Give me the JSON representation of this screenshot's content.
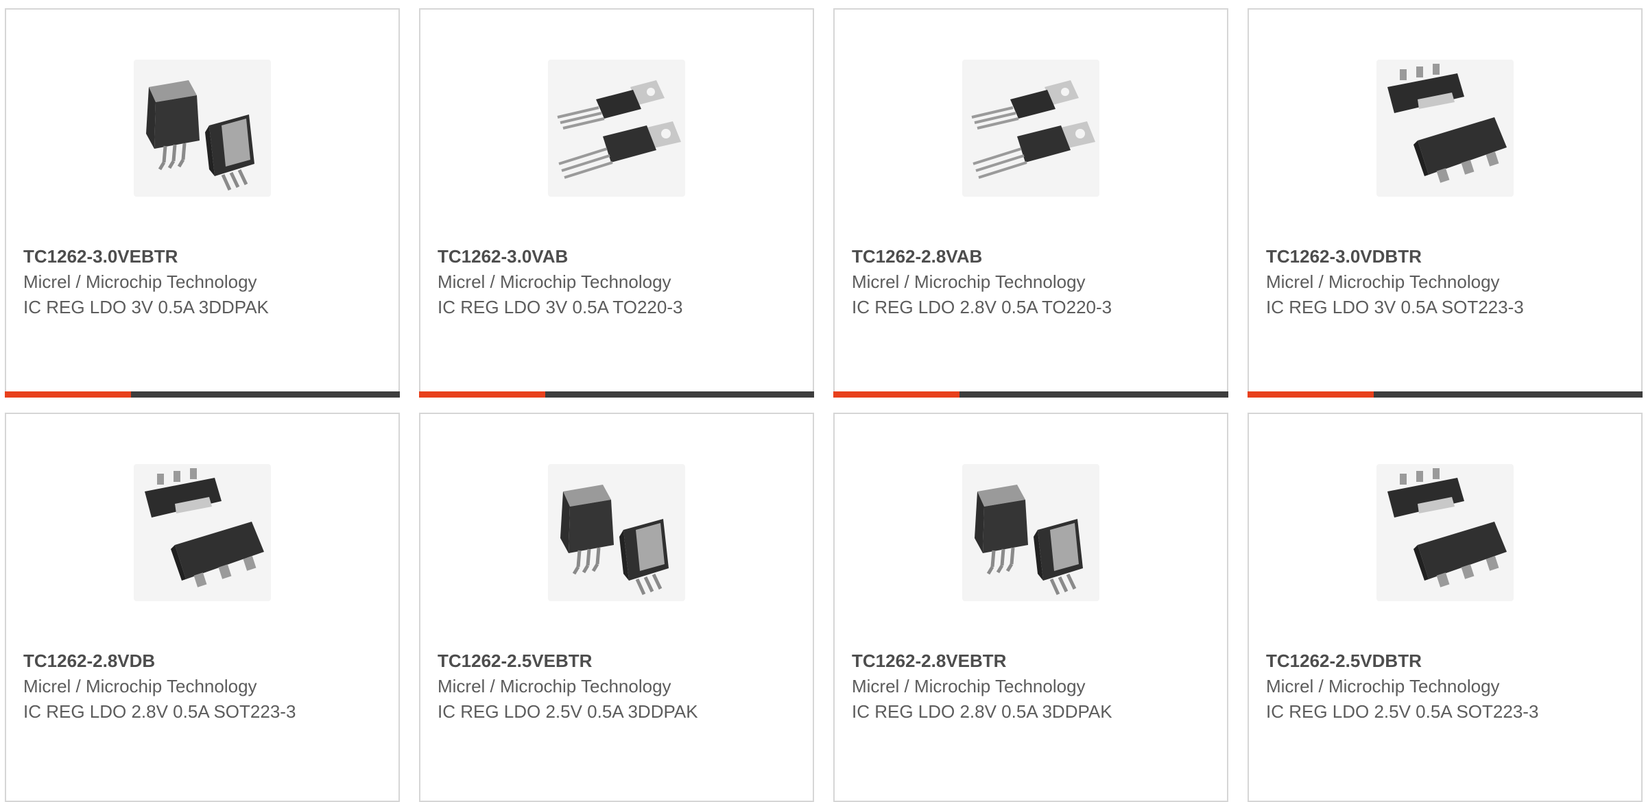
{
  "colors": {
    "accent": "#e8401c",
    "bar": "#3d3d3d",
    "border": "#d6d6d6",
    "text": "#5c5c5c"
  },
  "products": [
    {
      "part_number": "TC1262-3.0VEBTR",
      "manufacturer": "Micrel / Microchip Technology",
      "description": "IC REG LDO 3V 0.5A 3DDPAK",
      "package_icon": "ddpak-package-icon"
    },
    {
      "part_number": "TC1262-3.0VAB",
      "manufacturer": "Micrel / Microchip Technology",
      "description": "IC REG LDO 3V 0.5A TO220-3",
      "package_icon": "to220-package-icon"
    },
    {
      "part_number": "TC1262-2.8VAB",
      "manufacturer": "Micrel / Microchip Technology",
      "description": "IC REG LDO 2.8V 0.5A TO220-3",
      "package_icon": "to220-package-icon"
    },
    {
      "part_number": "TC1262-3.0VDBTR",
      "manufacturer": "Micrel / Microchip Technology",
      "description": "IC REG LDO 3V 0.5A SOT223-3",
      "package_icon": "sot223-package-icon"
    },
    {
      "part_number": "TC1262-2.8VDB",
      "manufacturer": "Micrel / Microchip Technology",
      "description": "IC REG LDO 2.8V 0.5A SOT223-3",
      "package_icon": "sot223-package-icon"
    },
    {
      "part_number": "TC1262-2.5VEBTR",
      "manufacturer": "Micrel / Microchip Technology",
      "description": "IC REG LDO 2.5V 0.5A 3DDPAK",
      "package_icon": "ddpak-package-icon"
    },
    {
      "part_number": "TC1262-2.8VEBTR",
      "manufacturer": "Micrel / Microchip Technology",
      "description": "IC REG LDO 2.8V 0.5A 3DDPAK",
      "package_icon": "ddpak-package-icon"
    },
    {
      "part_number": "TC1262-2.5VDBTR",
      "manufacturer": "Micrel / Microchip Technology",
      "description": "IC REG LDO 2.5V 0.5A SOT223-3",
      "package_icon": "sot223-package-icon"
    }
  ]
}
